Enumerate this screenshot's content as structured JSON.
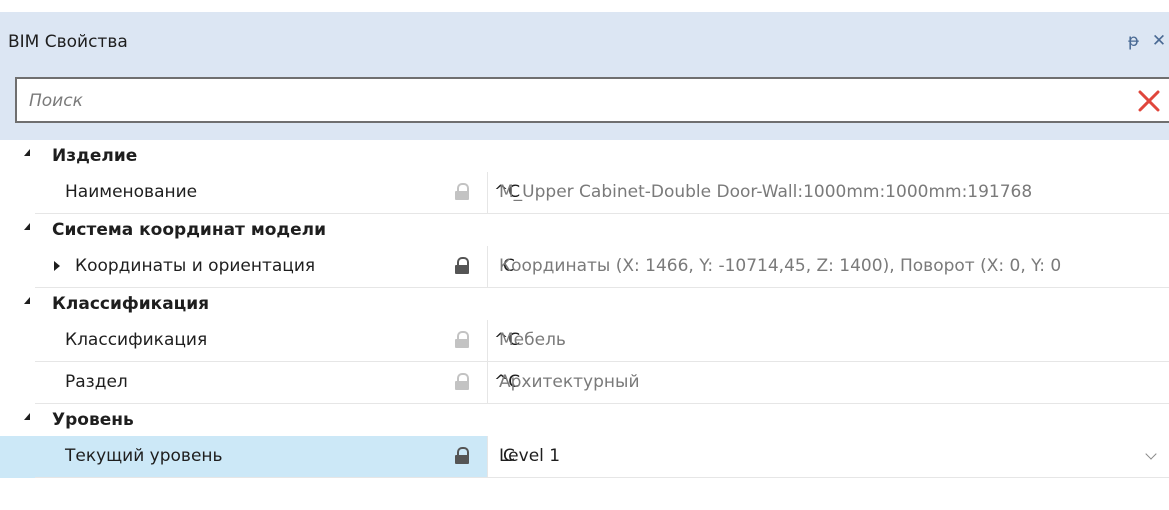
{
  "panel": {
    "title": "BIM Свойства",
    "pin_icon": "pin-icon",
    "close_icon": "close-icon",
    "pin_glyph": "ᵽ",
    "close_glyph": "✕"
  },
  "search": {
    "placeholder": "Поиск",
    "value": "",
    "clear_icon": "clear-search-icon",
    "clear_color": "#e0463c"
  },
  "groups": [
    {
      "label": "Изделие",
      "properties": [
        {
          "name": "Наименование",
          "lock": "light",
          "flag": "^C",
          "value": "M_Upper Cabinet-Double Door-Wall:1000mm:1000mm:191768"
        }
      ]
    },
    {
      "label": "Система координат модели",
      "properties": [
        {
          "name": "Координаты и ориентация",
          "lock": "dark",
          "flag": "C",
          "value": "Координаты (X: 1466, Y: -10714,45, Z: 1400), Поворот (X: 0, Y: 0",
          "expandable": true
        }
      ]
    },
    {
      "label": "Классификация",
      "properties": [
        {
          "name": "Классификация",
          "lock": "light",
          "flag": "^C",
          "value": "Мебель"
        },
        {
          "name": "Раздел",
          "lock": "light",
          "flag": "^C",
          "value": "Архитектурный"
        }
      ]
    },
    {
      "label": "Уровень",
      "properties": [
        {
          "name": "Текущий уровень",
          "lock": "dark",
          "flag": "C",
          "value": "Level 1",
          "selected": true,
          "dropdown": true
        }
      ]
    }
  ],
  "colors": {
    "header_bg": "#dce6f3",
    "selected_bg": "#cce8f7",
    "muted_text": "#7a7a7a"
  }
}
